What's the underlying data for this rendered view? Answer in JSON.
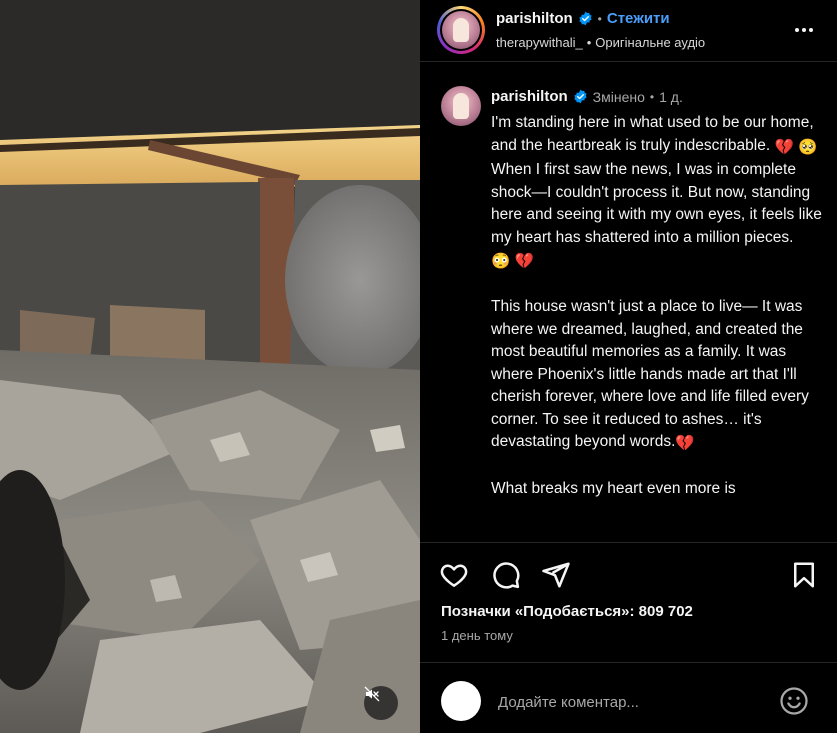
{
  "post": {
    "username": "parishilton",
    "follow_label": "Стежити",
    "audio_user": "therapywithali_",
    "audio_label": "Оригінальне аудіо"
  },
  "caption": {
    "username": "parishilton",
    "edited_label": "Змінено",
    "time": "1 д.",
    "p1a": "I'm standing here in what used to be our home, and the heartbreak is truly indescribable.",
    "p1b": " When I first saw the news, I was in complete shock—I couldn't process it. But now, standing here and seeing it with my own eyes, it feels like my heart has shattered into a million pieces.",
    "p2": "This house wasn't just a place to live— It was where we dreamed, laughed, and created the most beautiful memories as a family. It was where Phoenix's little hands made art that I'll cherish forever, where love and life filled every corner. To see it reduced to ashes… it's devastating beyond words.",
    "p3": "What breaks my heart even more is",
    "emoji": {
      "broken_heart": "💔",
      "pleading": "🥺",
      "flushed": "😳"
    }
  },
  "engagement": {
    "likes_text": "Позначки «Подобається»: 809 702",
    "time_ago": "1 день тому"
  },
  "comment_box": {
    "placeholder": "Додайте коментар..."
  },
  "icons": {
    "like": "heart-icon",
    "comment": "comment-icon",
    "share": "send-icon",
    "save": "bookmark-icon",
    "more": "more-icon",
    "mute": "muted-speaker-icon",
    "emoji": "emoji-icon",
    "verified": "verified-icon"
  },
  "colors": {
    "accent": "#4a9df8",
    "background": "#000000",
    "muted_text": "#a8a8a8"
  }
}
